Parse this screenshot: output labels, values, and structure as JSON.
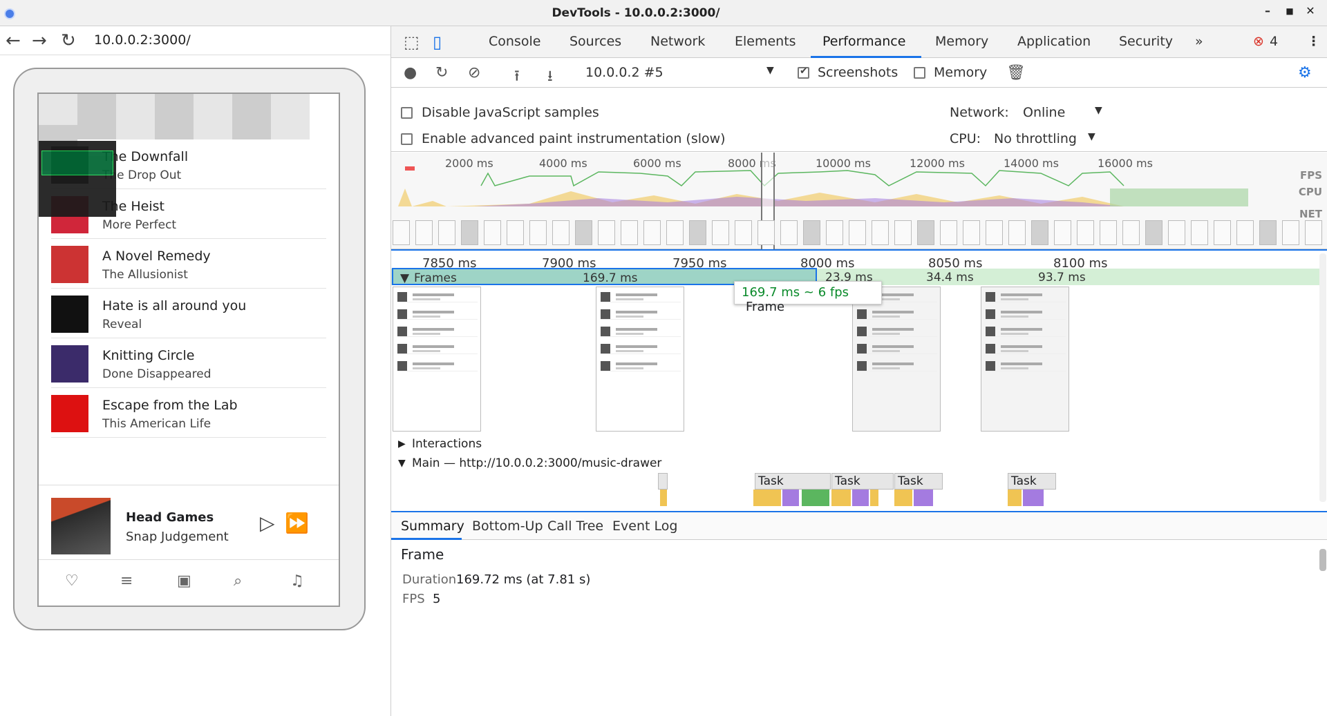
{
  "window": {
    "title": "DevTools - 10.0.0.2:3000/"
  },
  "browser": {
    "url": "10.0.0.2:3000/"
  },
  "app": {
    "songs": [
      {
        "title": "The Downfall",
        "artist": "The Drop Out",
        "color": "#2c2c2c"
      },
      {
        "title": "The Heist",
        "artist": "More Perfect",
        "color": "#d0263a"
      },
      {
        "title": "A Novel Remedy",
        "artist": "The Allusionist",
        "color": "#c33"
      },
      {
        "title": "Hate is all around you",
        "artist": "Reveal",
        "color": "#111"
      },
      {
        "title": "Knitting Circle",
        "artist": "Done Disappeared",
        "color": "#3b2b6a"
      },
      {
        "title": "Escape from the Lab",
        "artist": "This American Life",
        "color": "#d11"
      }
    ],
    "player": {
      "title": "Head Games",
      "artist": "Snap Judgement"
    }
  },
  "devtools": {
    "tabs": [
      "Console",
      "Sources",
      "Network",
      "Elements",
      "Performance",
      "Memory",
      "Application",
      "Security"
    ],
    "active_tab": "Performance",
    "error_count": "4",
    "recording": "10.0.0.2 #5",
    "screenshots_label": "Screenshots",
    "memory_label": "Memory",
    "disable_js_label": "Disable JavaScript samples",
    "paint_label": "Enable advanced paint instrumentation (slow)",
    "network_label": "Network:",
    "network_value": "Online",
    "cpu_label": "CPU:",
    "cpu_value": "No throttling",
    "overview_ticks": [
      "2000 ms",
      "4000 ms",
      "6000 ms",
      "8000 ms",
      "10000 ms",
      "12000 ms",
      "14000 ms",
      "16000 ms"
    ],
    "overview_tracks": [
      "FPS",
      "CPU",
      "NET"
    ],
    "timeline_ticks": [
      "7850 ms",
      "7900 ms",
      "7950 ms",
      "8000 ms",
      "8050 ms",
      "8100 ms"
    ],
    "frames_label": "Frames",
    "frame_durations": [
      "169.7 ms",
      "23.9 ms",
      "34.4 ms",
      "93.7 ms"
    ],
    "tooltip": {
      "duration": "169.7 ms ~ 6 fps",
      "label": "Frame"
    },
    "interactions_label": "Interactions",
    "main_label": "Main — http://10.0.0.2:3000/music-drawer",
    "tasks": [
      "Task",
      "Task",
      "Task",
      "Task"
    ],
    "panel_tabs": [
      "Summary",
      "Bottom-Up",
      "Call Tree",
      "Event Log"
    ],
    "summary": {
      "heading": "Frame",
      "duration_label": "Duration",
      "duration_value": "169.72 ms (at 7.81 s)",
      "fps_label": "FPS",
      "fps_value": "5"
    },
    "colors": {
      "accent": "#1a73e8",
      "scripting": "#f0c453",
      "rendering": "#a47be0",
      "painting": "#5bb65f"
    }
  }
}
